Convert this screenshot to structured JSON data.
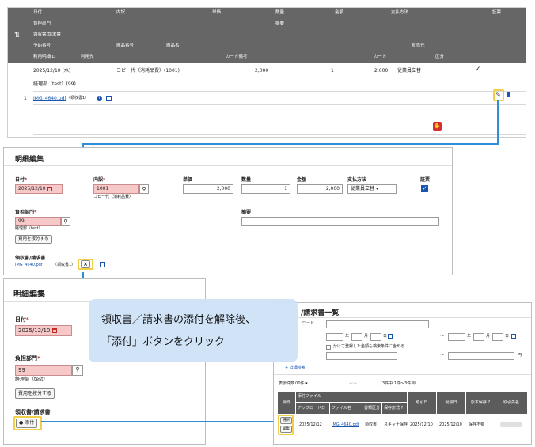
{
  "top_table": {
    "headers_row1": [
      "日付",
      "内訳",
      "単価",
      "数量",
      "金額",
      "支払方法",
      "証票"
    ],
    "headers_row2": [
      "負担部門",
      "摘要"
    ],
    "headers_row3": [
      "領収書/請求書"
    ],
    "headers_row4": [
      "予約番号",
      "商品番号",
      "商品名",
      "販売元"
    ],
    "headers_row5": [
      "利用明細ID",
      "利用先",
      "カード備考",
      "カード",
      "区分"
    ],
    "row": {
      "date": "2025/12/10 (水)",
      "item": "コピー代（消耗品費）(1001)",
      "unit_price": "2,000",
      "qty": "1",
      "amount": "2,000",
      "payment": "従業員立替",
      "check": "✓",
      "dept": "経理部（test）(99)",
      "index": "1",
      "file": "IMG_4640.pdf",
      "file_note": "（領収書1）"
    }
  },
  "edit1": {
    "title": "明細編集",
    "date_label": "日付",
    "date_value": "2025/12/10",
    "item_label": "内訳",
    "item_code": "1001",
    "item_name": "コピー代（消耗品費）",
    "unit_label": "単価",
    "unit_value": "2,000",
    "qty_label": "数量",
    "qty_value": "1",
    "amount_label": "金額",
    "amount_value": "2,000",
    "pay_label": "支払方法",
    "pay_value": "従業員立替",
    "voucher_label": "証票",
    "dept_label": "負担部門",
    "dept_code": "99",
    "dept_name": "経理部（test）",
    "split_button": "費用を按分する",
    "memo_label": "摘要",
    "receipt_label": "領収書/請求書",
    "file": "IMG_4640.pdf",
    "file_note": "（領収書1）",
    "remove": "×"
  },
  "edit2": {
    "title": "明細編集",
    "date_label": "日付",
    "date_value": "2025/12/10",
    "dept_label": "負担部門",
    "dept_code": "99",
    "dept_name": "経理部（test）",
    "split_button": "費用を按分する",
    "receipt_label": "領収書/請求書",
    "attach_button": "添付"
  },
  "callout": {
    "line1": "領収書／請求書の添付を解除後、",
    "line2": "「添付」ボタンをクリック"
  },
  "list": {
    "title": "/請求書一覧",
    "keyword_label": "ワード",
    "year": "年",
    "month": "月",
    "day": "日",
    "tilde": "～",
    "yen": "円",
    "split_check": "分けて登録した金額も検索条件に含める",
    "detail_search": "+ 詳細検索",
    "count_label": "表示件数",
    "count_value": "100件",
    "range_text": "（3件中 1件～3件目）",
    "col_op": "操作",
    "col_attached": "添付ファイル",
    "col_upload": "アップロード日",
    "col_filename": "ファイル名",
    "col_doctype": "書類区分",
    "col_method": "保存形式",
    "col_trade_date": "取引日",
    "col_receive_date": "受領日",
    "col_original": "原本保存",
    "col_partner": "取引先名",
    "btn_select": "選択",
    "btn_edit": "編集",
    "row_upload": "2025/12/12",
    "row_file": "IMG_4640.pdf",
    "row_doctype": "領収書",
    "row_method": "スキャナ保存",
    "row_trade": "2025/12/10",
    "row_receive": "2025/12/10",
    "row_original": "保存不要"
  }
}
